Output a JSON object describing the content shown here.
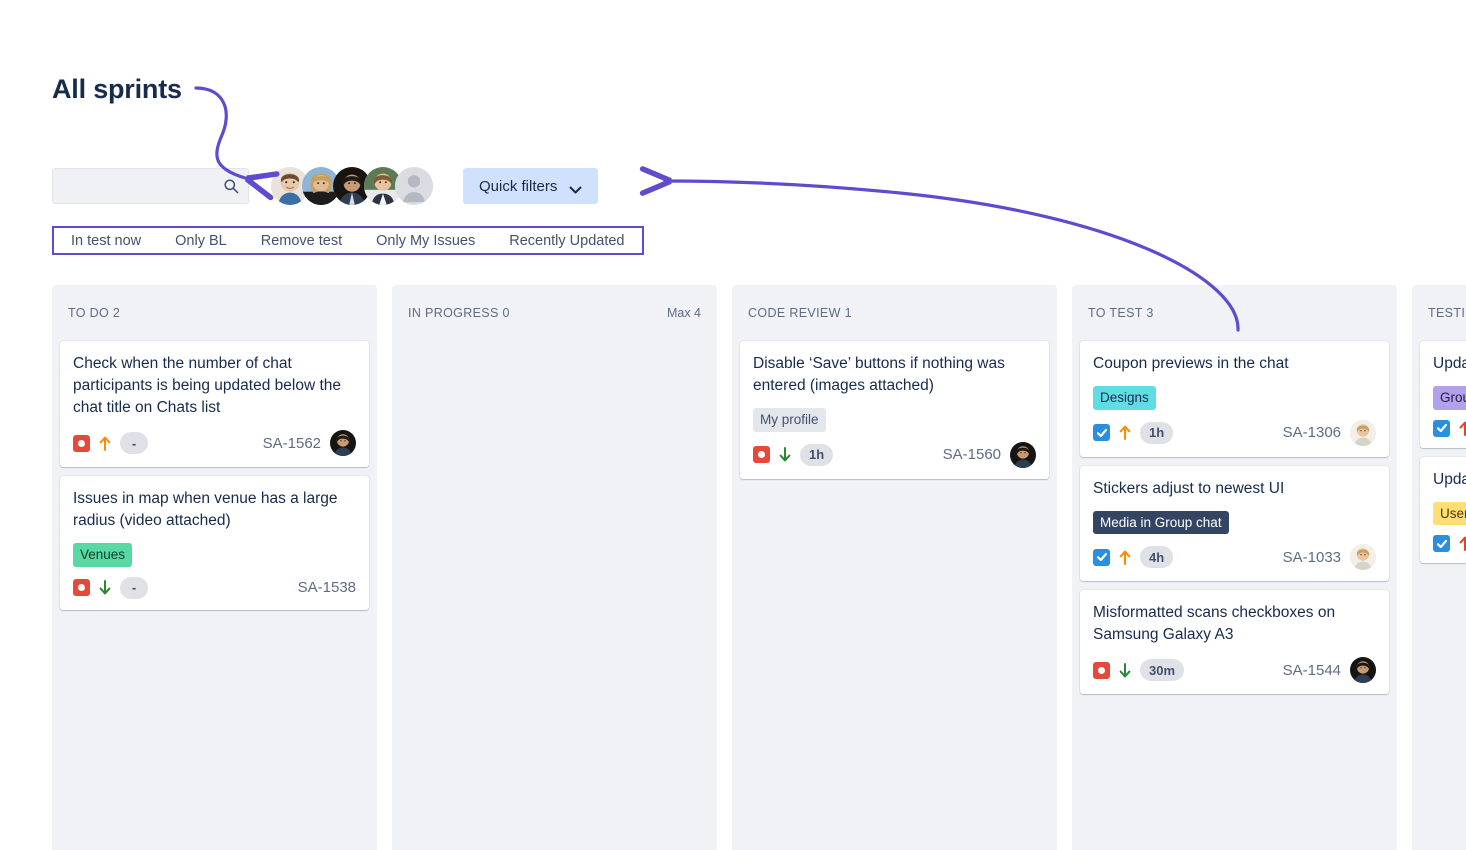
{
  "page": {
    "heading": "All sprints"
  },
  "toolbar": {
    "search": {
      "value": "",
      "placeholder": "",
      "icon": "search-icon"
    },
    "avatars": [
      {
        "name": "avatar-1",
        "kind": "photo",
        "skin": "#e8c9a8",
        "hair": "#6b4a2f",
        "bg": "#e9e3dc",
        "shirt": "#3c6fa5"
      },
      {
        "name": "avatar-2",
        "kind": "photo",
        "skin": "#e3bb98",
        "hair": "#c8a05a",
        "bg": "#8fb4d6",
        "shirt": "#1c1c1c"
      },
      {
        "name": "avatar-3",
        "kind": "photo",
        "skin": "#c99a72",
        "hair": "#1d1913",
        "bg": "#171512",
        "shirt": "#2e3e52"
      },
      {
        "name": "avatar-4",
        "kind": "photo",
        "skin": "#e8c3a2",
        "hair": "#7d5b34",
        "bg": "#5c7b54",
        "shirt": "#2c3442"
      },
      {
        "name": "avatar-placeholder",
        "kind": "placeholder",
        "bg": "#dadce1",
        "fg": "#b3b8c2"
      }
    ],
    "quick_filters": {
      "label": "Quick filters",
      "icon": "chevron-down-icon"
    }
  },
  "filter_tabs": [
    {
      "label": "In test now"
    },
    {
      "label": "Only BL"
    },
    {
      "label": "Remove test"
    },
    {
      "label": "Only My Issues"
    },
    {
      "label": "Recently Updated"
    }
  ],
  "colors": {
    "annotation_purple": "#5f4bce",
    "quick_filters_bg": "#cfe1fd",
    "column_bg": "#f1f2f5",
    "bug_red": "#e5493a",
    "task_blue": "#2b8fe0",
    "prio_high_orange": "#ff8b00",
    "prio_high_red": "#e8402b",
    "prio_low_green": "#2a8735"
  },
  "board": {
    "columns": [
      {
        "name": "to-do",
        "title": "TO DO",
        "count": "2",
        "max": "",
        "cards": [
          {
            "title": "Check when the number of chat participants is being updated below the chat title on Chats list",
            "badges": [],
            "type": "bug",
            "priority": "up-orange",
            "estimate": "-",
            "key": "SA-1562",
            "avatar": {
              "kind": "photo",
              "skin": "#c99a72",
              "hair": "#1d1913",
              "bg": "#171512",
              "shirt": "#2e3e52"
            }
          },
          {
            "title": "Issues in map when venue has a large radius (video attached)",
            "badges": [
              {
                "text": "Venues",
                "bg": "#57d9a3",
                "fg": "#0b3b2e"
              }
            ],
            "type": "bug",
            "priority": "down-green",
            "estimate": "-",
            "key": "SA-1538",
            "avatar": null
          }
        ]
      },
      {
        "name": "in-progress",
        "title": "IN PROGRESS",
        "count": "0",
        "max": "Max 4",
        "cards": []
      },
      {
        "name": "code-review",
        "title": "CODE REVIEW",
        "count": "1",
        "max": "",
        "cards": [
          {
            "title": "Disable ‘Save’ buttons if nothing was entered (images attached)",
            "badges": [
              {
                "text": "My profile",
                "bg": "#e3e6ea",
                "fg": "#42526e"
              }
            ],
            "type": "bug",
            "priority": "down-green",
            "estimate": "1h",
            "key": "SA-1560",
            "avatar": {
              "kind": "photo",
              "skin": "#c99a72",
              "hair": "#1d1913",
              "bg": "#171512",
              "shirt": "#2e3e52"
            }
          }
        ]
      },
      {
        "name": "to-test",
        "title": "TO TEST",
        "count": "3",
        "max": "",
        "cards": [
          {
            "title": "Coupon previews in the chat",
            "badges": [
              {
                "text": "Designs",
                "bg": "#5fdde5",
                "fg": "#172b4d"
              }
            ],
            "type": "task",
            "priority": "up-orange",
            "estimate": "1h",
            "key": "SA-1306",
            "avatar": {
              "kind": "photo",
              "skin": "#eac39f",
              "hair": "#c7a062",
              "bg": "#f2efe9",
              "shirt": "#d8d2c8"
            }
          },
          {
            "title": "Stickers adjust to newest UI",
            "badges": [
              {
                "text": "Media in Group chat",
                "bg": "#344563",
                "fg": "#ffffff"
              }
            ],
            "type": "task",
            "priority": "up-orange",
            "estimate": "4h",
            "key": "SA-1033",
            "avatar": {
              "kind": "photo",
              "skin": "#eac39f",
              "hair": "#c7a062",
              "bg": "#f2efe9",
              "shirt": "#d8d2c8"
            }
          },
          {
            "title": "Misformatted scans checkboxes on Samsung Galaxy A3",
            "badges": [],
            "type": "bug",
            "priority": "down-green",
            "estimate": "30m",
            "key": "SA-1544",
            "avatar": {
              "kind": "photo",
              "skin": "#c99a72",
              "hair": "#1d1913",
              "bg": "#171512",
              "shirt": "#2e3e52"
            }
          }
        ]
      },
      {
        "name": "testing",
        "title": "TESTING",
        "count": "",
        "max": "",
        "cards": [
          {
            "title": "Update public",
            "badges": [
              {
                "text": "Group",
                "bg": "#b3a1ef",
                "fg": "#2b2040"
              }
            ],
            "type": "task",
            "priority": "up-red",
            "estimate": "",
            "key": "",
            "avatar": null
          },
          {
            "title": "Update on chat screen",
            "badges": [
              {
                "text": "Users",
                "bg": "#ffdf73",
                "fg": "#4a3a00"
              }
            ],
            "type": "task",
            "priority": "up-red",
            "estimate": "",
            "key": "",
            "avatar": null
          }
        ]
      }
    ]
  },
  "annotations": [
    {
      "name": "arrow-all-sprints-to-avatars",
      "color": "#5f4bce"
    },
    {
      "name": "arrow-to-quick-filters",
      "color": "#5f4bce"
    },
    {
      "name": "highlight-filter-tabs",
      "color": "#5f4bce"
    }
  ]
}
